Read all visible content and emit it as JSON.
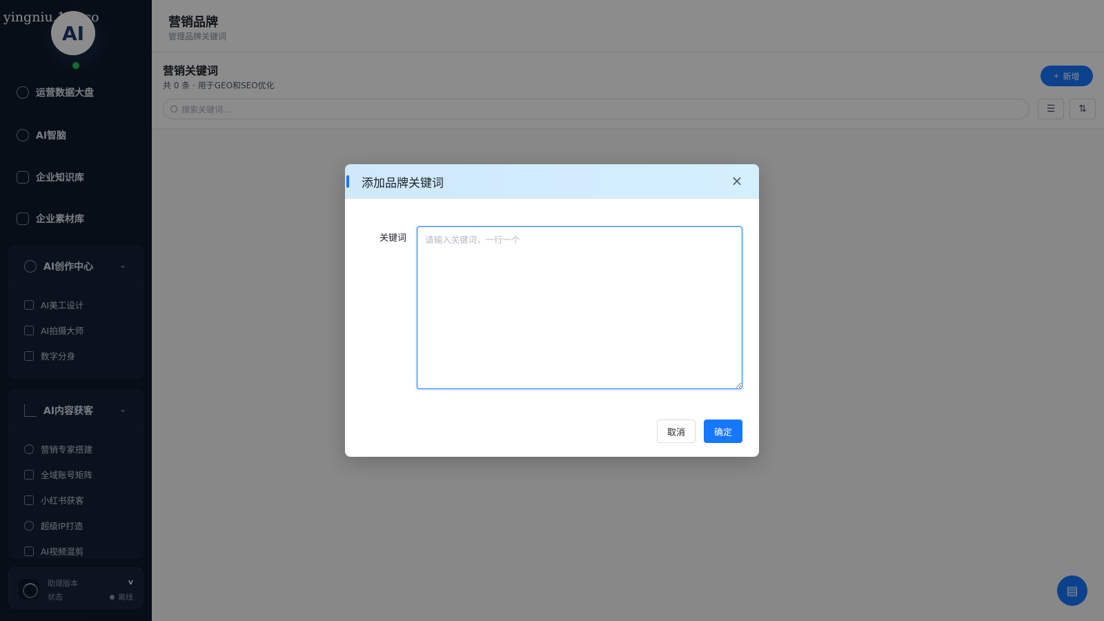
{
  "watermark": "yingniu.10v.co",
  "avatar": {
    "text": "AI"
  },
  "sidebar": {
    "items": [
      {
        "label": "运营数据大盘"
      },
      {
        "label": "AI智脑"
      },
      {
        "label": "企业知识库"
      },
      {
        "label": "企业素材库"
      }
    ],
    "groups": [
      {
        "title": "AI创作中心",
        "items": [
          "AI美工设计",
          "AI拍摄大师",
          "数字分身"
        ]
      },
      {
        "title": "AI内容获客",
        "items": [
          "营销专家搭建",
          "全域账号矩阵",
          "小红书获客",
          "超级IP打造",
          "AI视频混剪"
        ]
      }
    ],
    "status": {
      "version_label": "助理版本",
      "version_value": "v",
      "state_label": "状态",
      "state_value": "离线"
    }
  },
  "header": {
    "title": "营销品牌",
    "subtitle": "管理品牌关键词"
  },
  "section": {
    "title": "营销关键词",
    "subtitle": "共 0 条 · 用于GEO和SEO优化",
    "add_label": "新增",
    "search_placeholder": "搜索关键词..."
  },
  "modal": {
    "title": "添加品牌关键词",
    "field_label": "关键词",
    "textarea_placeholder": "请输入关键词，一行一个",
    "cancel_label": "取消",
    "confirm_label": "确定"
  },
  "colors": {
    "primary": "#1677ff",
    "sidebar_bg": "#0f1b2d",
    "online": "#22c55e"
  },
  "icons": {
    "close": "close-icon",
    "add": "plus-icon",
    "filter": "filter-icon",
    "sort": "sort-icon",
    "fab": "book-icon"
  }
}
